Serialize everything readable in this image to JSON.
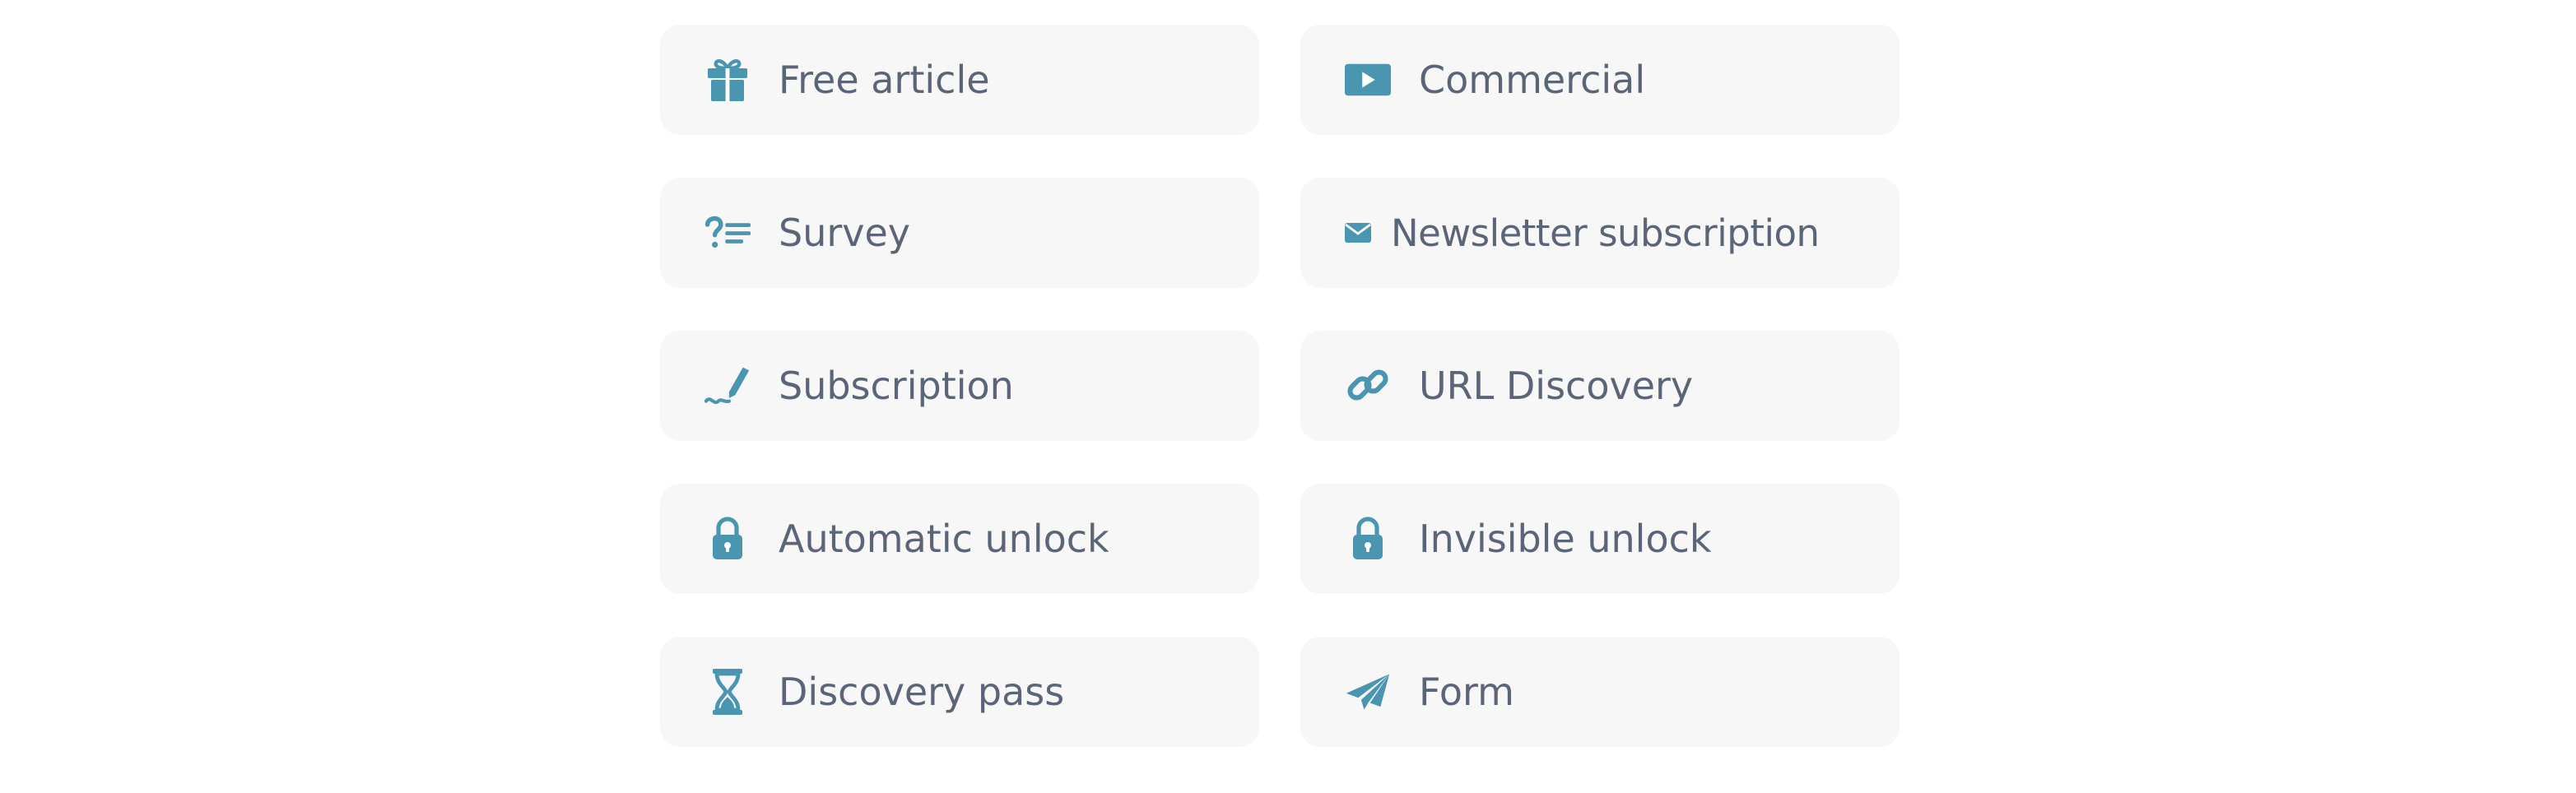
{
  "accent_color": "#4a95b0",
  "text_color": "#5a6577",
  "tile_background": "#f7f7f8",
  "options": [
    {
      "label": "Free article",
      "icon": "gift-icon"
    },
    {
      "label": "Commercial",
      "icon": "video-play-icon"
    },
    {
      "label": "Survey",
      "icon": "survey-question-icon"
    },
    {
      "label": "Newsletter subscription",
      "icon": "envelope-icon"
    },
    {
      "label": "Subscription",
      "icon": "signature-pen-icon"
    },
    {
      "label": "URL Discovery",
      "icon": "link-icon"
    },
    {
      "label": "Automatic unlock",
      "icon": "lock-icon"
    },
    {
      "label": "Invisible unlock",
      "icon": "lock-icon"
    },
    {
      "label": "Discovery pass",
      "icon": "hourglass-icon"
    },
    {
      "label": "Form",
      "icon": "paper-plane-icon"
    }
  ]
}
